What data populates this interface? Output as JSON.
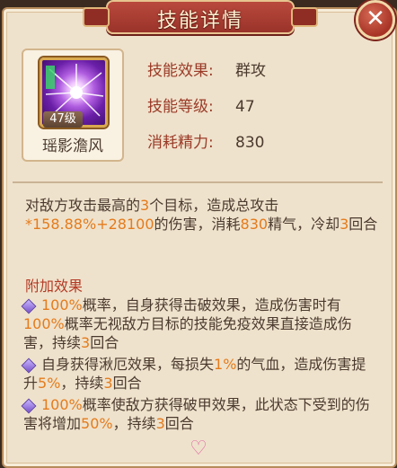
{
  "header": {
    "title": "技能详情"
  },
  "close_button": {
    "label": "✕"
  },
  "skill": {
    "level_badge": "47级",
    "name": "瑶影澹风"
  },
  "info": [
    {
      "label": "技能效果:",
      "value": "群攻"
    },
    {
      "label": "技能等级:",
      "value": "47"
    },
    {
      "label": "消耗精力:",
      "value": "830"
    }
  ],
  "description": {
    "p1": "对敌方攻击最高的",
    "p2": "3",
    "p3": "个目标，造成总攻击",
    "p4": "*158.88%+28100",
    "p5": "的伤害，消耗",
    "p6": "830",
    "p7": "精气，冷却",
    "p8": "3",
    "p9": "回合"
  },
  "extra": {
    "title": "附加效果",
    "e1": {
      "a": "100%",
      "b": "概率，自身获得击破效果，造成伤害时有",
      "c": "100%",
      "d": "概率无视敌方目标的技能免疫效果直接造成伤害，持续",
      "e": "3",
      "f": "回合"
    },
    "e2": {
      "a": "自身获得湫厄效果，每损失",
      "b": "1%",
      "c": "的气血，造成伤害提升",
      "d": "5%",
      "e": "，持续",
      "f": "3",
      "g": "回合"
    },
    "e3": {
      "a": "100%",
      "b": "概率使敌方获得破甲效果，此状态下受到的伤害将增加",
      "c": "50%",
      "d": "，持续",
      "e": "3",
      "f": "回合"
    }
  },
  "colors": {
    "accent": "#e47b1c",
    "title_red": "#b33a25",
    "panel_bg": "#efe2cc"
  }
}
